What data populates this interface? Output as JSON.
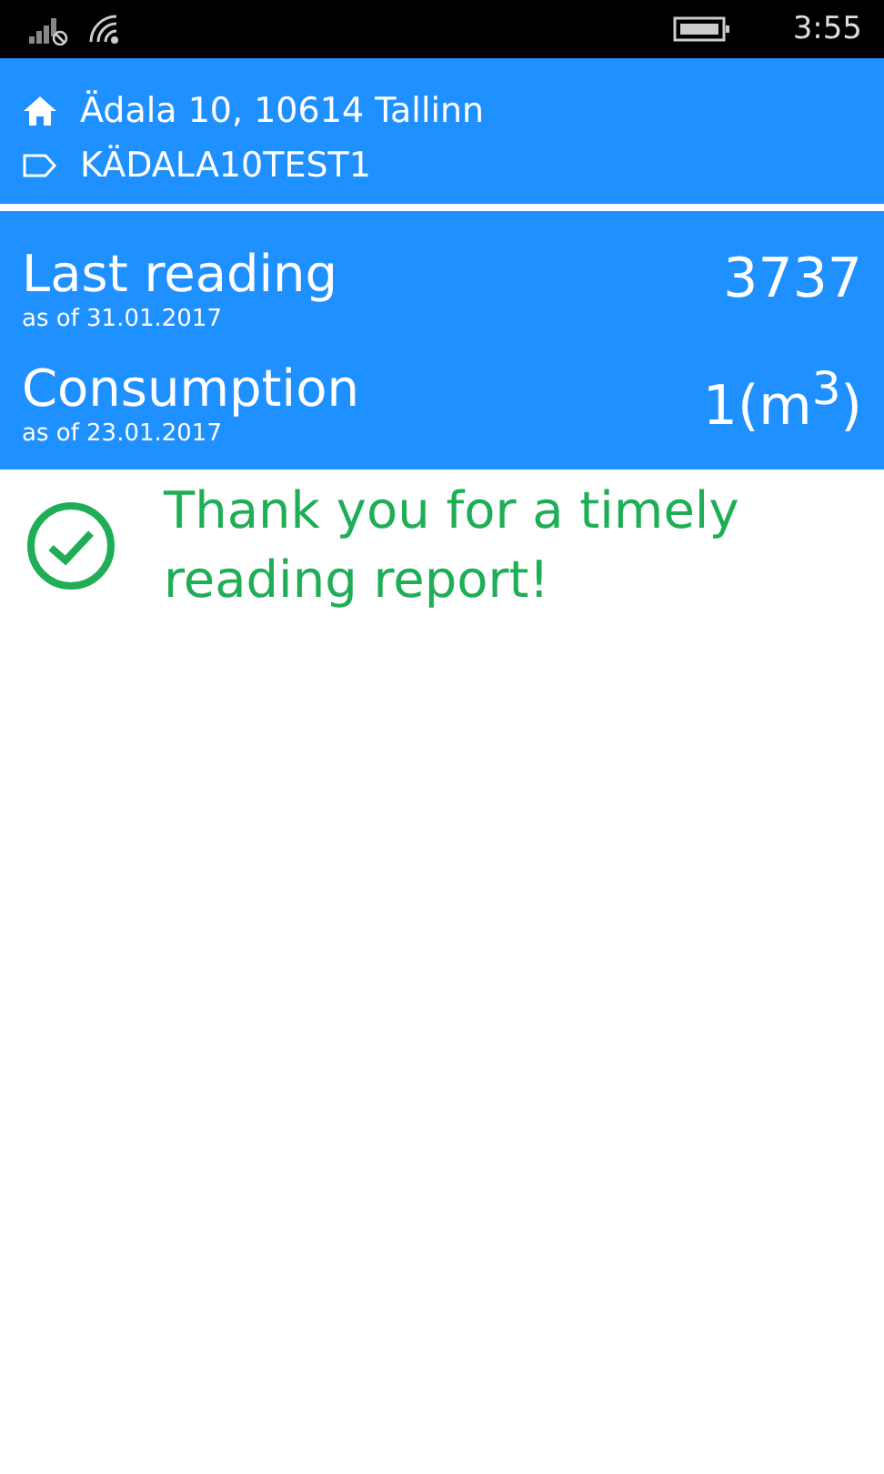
{
  "status_bar": {
    "time": "3:55"
  },
  "location": {
    "address": "Ädala 10, 10614 Tallinn",
    "meter_id": "KÄDALA10TEST1"
  },
  "readings": [
    {
      "title": "Last reading",
      "date": "as of 31.01.2017",
      "value": "3737"
    },
    {
      "title": "Consumption",
      "date": "as of 23.01.2017",
      "value": "1(m$^{3}$)"
    }
  ],
  "message": {
    "text": "Thank you for a timely reading report!"
  }
}
